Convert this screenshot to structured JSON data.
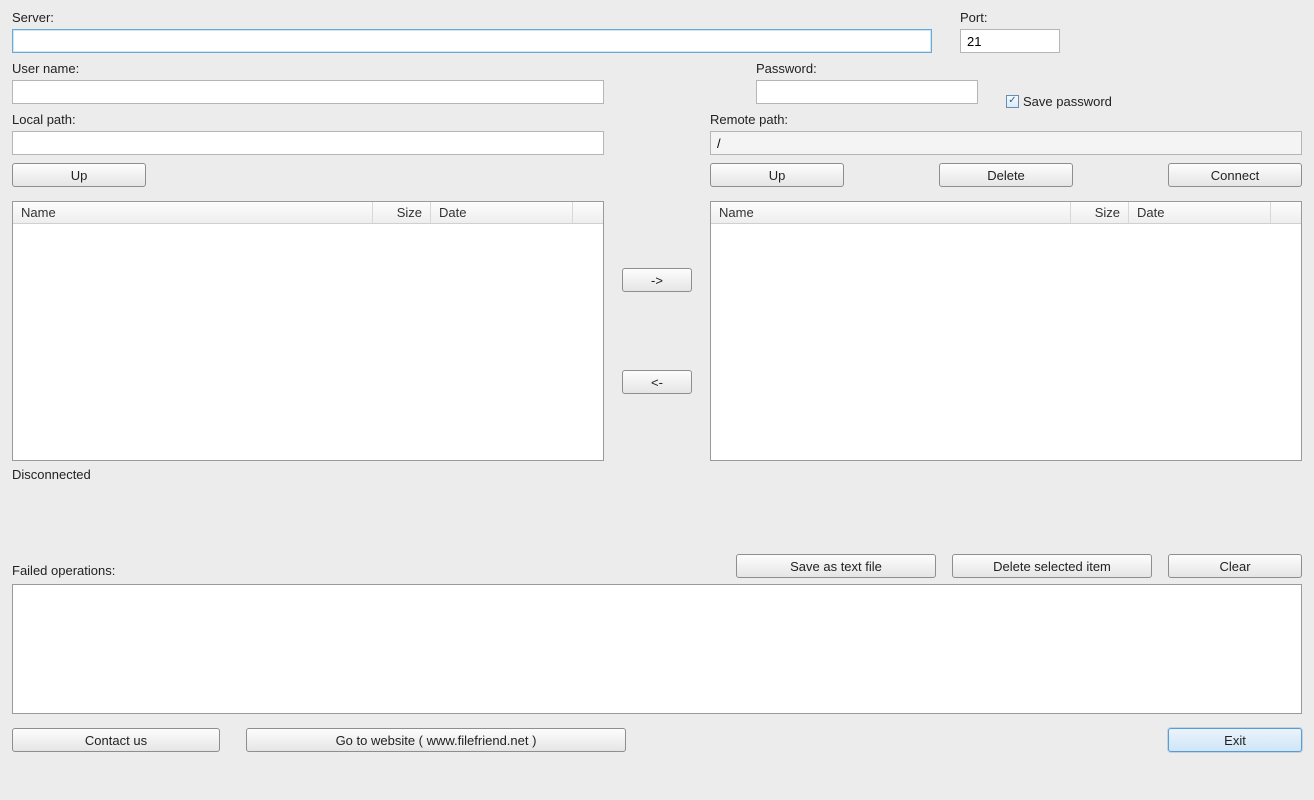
{
  "labels": {
    "server": "Server:",
    "port": "Port:",
    "username": "User name:",
    "password": "Password:",
    "save_password": "Save password",
    "local_path": "Local path:",
    "remote_path": "Remote path:",
    "failed_ops": "Failed operations:"
  },
  "values": {
    "server": "",
    "port": "21",
    "username": "",
    "password": "",
    "save_password_checked": true,
    "local_path": "",
    "remote_path": "/"
  },
  "buttons": {
    "up": "Up",
    "delete": "Delete",
    "connect": "Connect",
    "transfer_right": "->",
    "transfer_left": "<-",
    "save_text": "Save as text file",
    "delete_selected": "Delete selected item",
    "clear": "Clear",
    "contact": "Contact us",
    "website": "Go to website ( www.filefriend.net )",
    "exit": "Exit"
  },
  "columns": {
    "name": "Name",
    "size": "Size",
    "date": "Date"
  },
  "status": "Disconnected"
}
